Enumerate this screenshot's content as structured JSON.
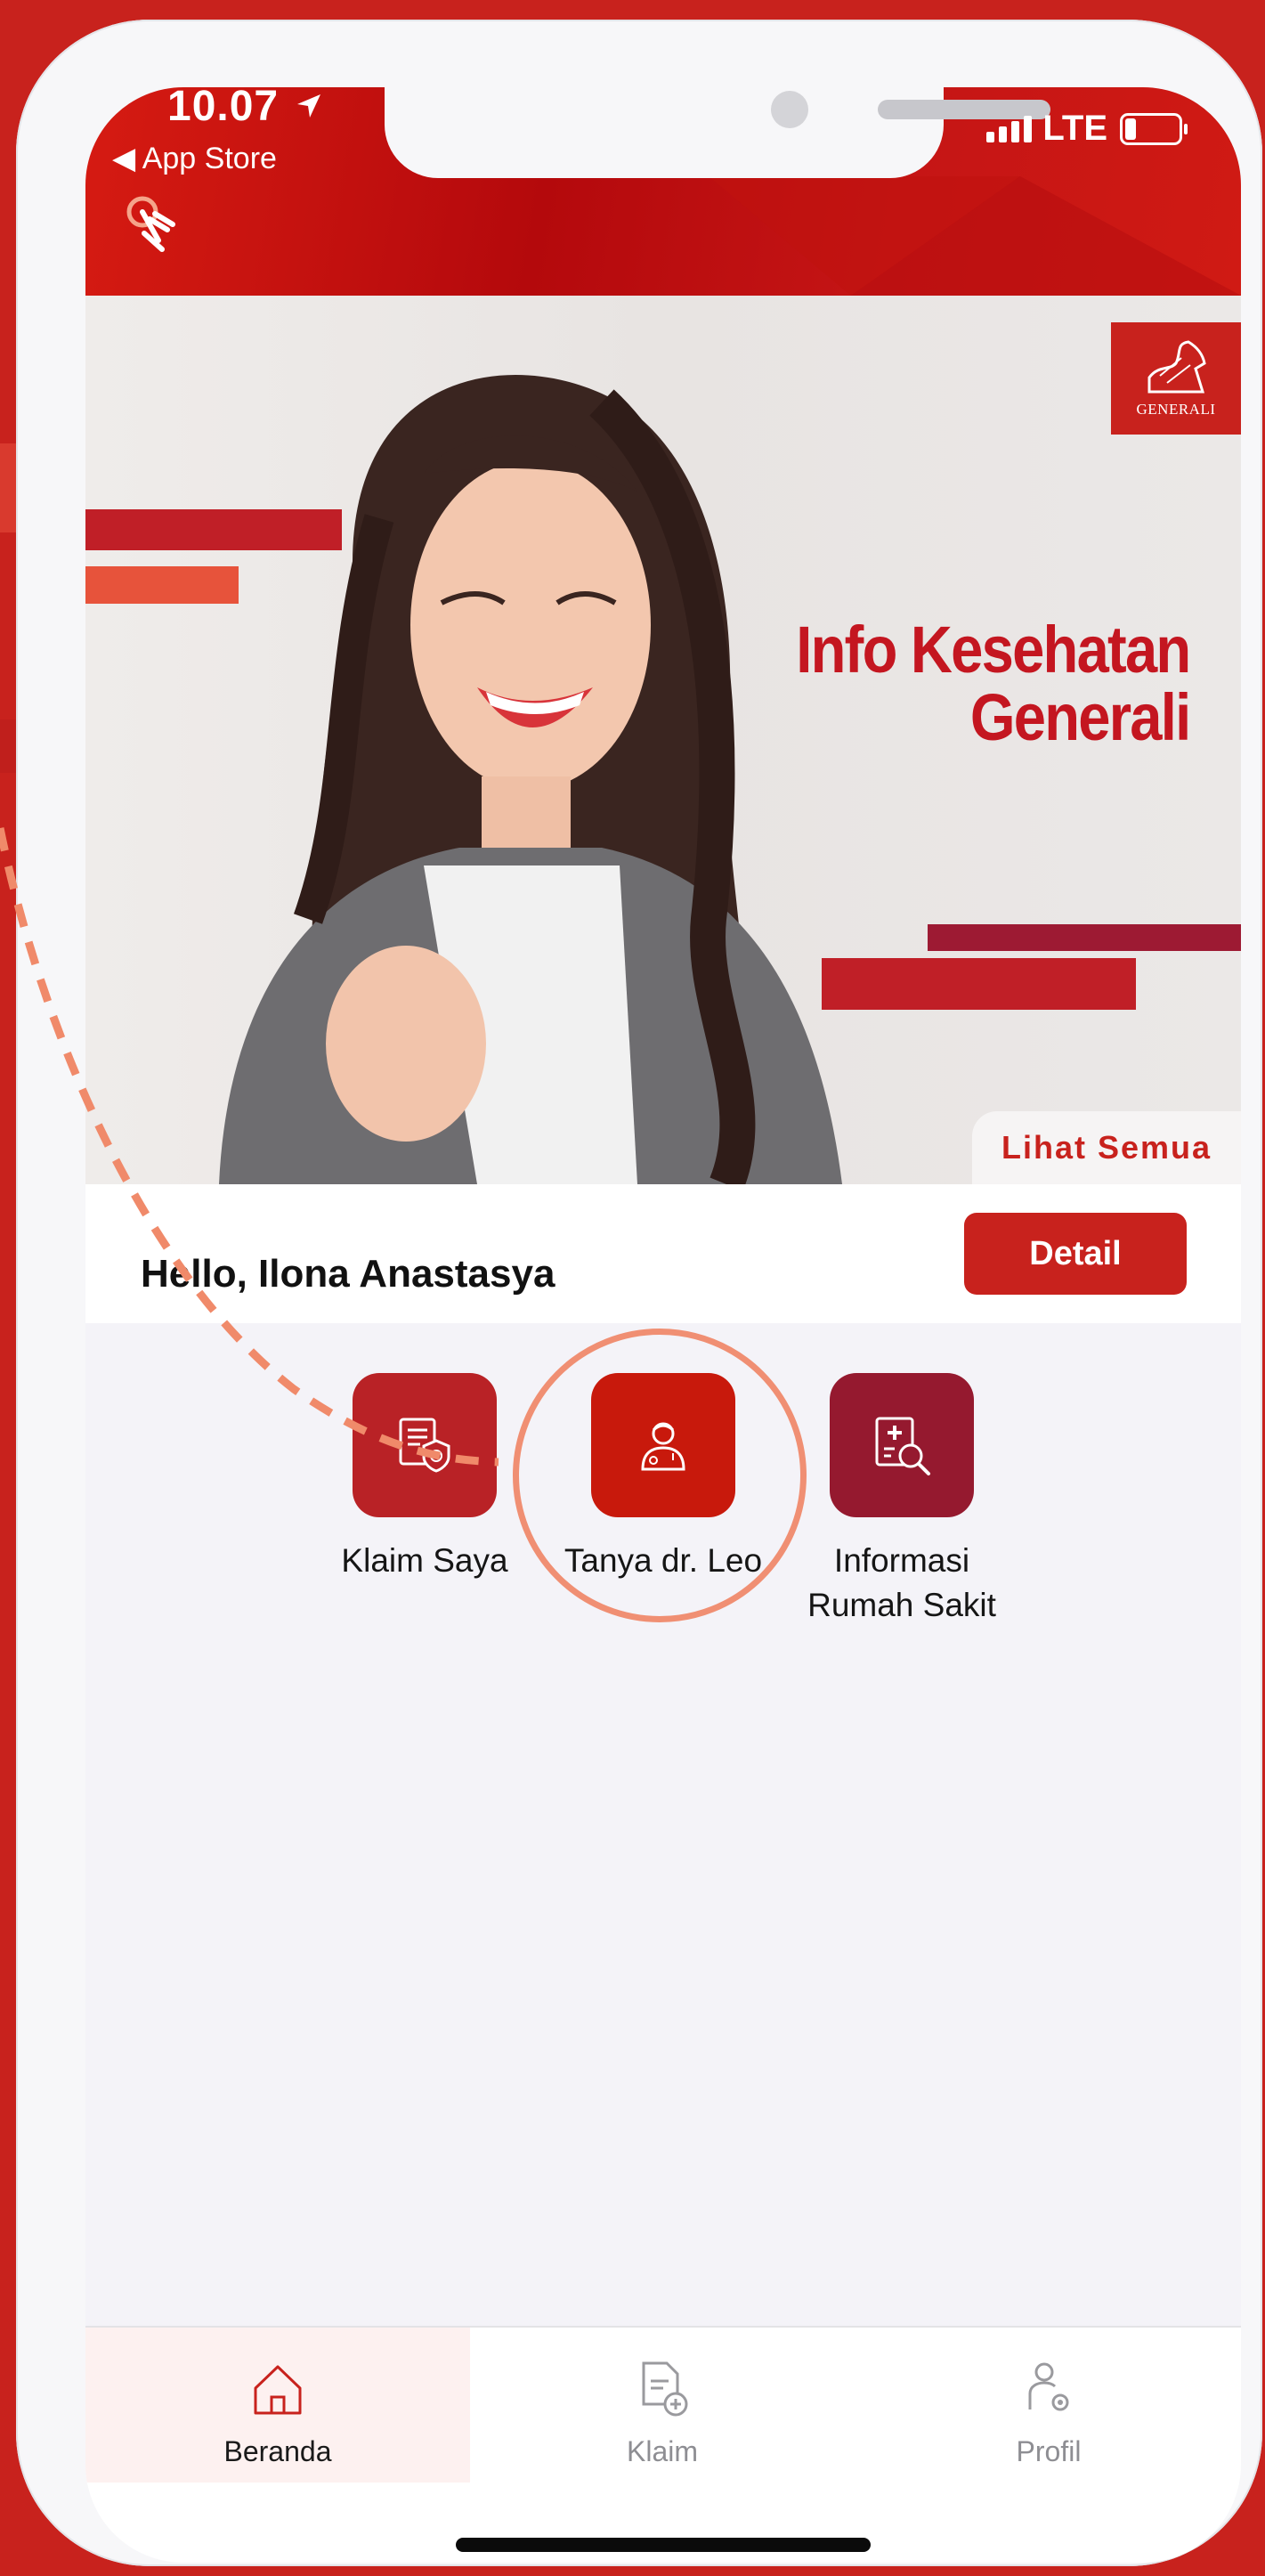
{
  "status_bar": {
    "time": "10.07",
    "back_label": "App Store",
    "network": "LTE"
  },
  "banner": {
    "title_line1": "Info Kesehatan",
    "title_line2": "Generali",
    "logo_text": "GENERALI",
    "see_all_label": "Lihat Semua"
  },
  "greeting": {
    "text": "Hello, Ilona Anastasya",
    "detail_label": "Detail"
  },
  "menu": [
    {
      "label": "Klaim Saya",
      "color": "#b92226"
    },
    {
      "label": "Tanya dr. Leo",
      "color": "#c8190c"
    },
    {
      "label_line1": "Informasi",
      "label_line2": "Rumah Sakit",
      "color": "#95192f"
    }
  ],
  "bottom_nav": [
    {
      "label": "Beranda",
      "icon": "home-icon",
      "active": true
    },
    {
      "label": "Klaim",
      "icon": "document-add-icon",
      "active": false
    },
    {
      "label": "Profil",
      "icon": "user-settings-icon",
      "active": false
    }
  ],
  "colors": {
    "brand_red": "#c8221d",
    "highlight": "#f08f73"
  }
}
